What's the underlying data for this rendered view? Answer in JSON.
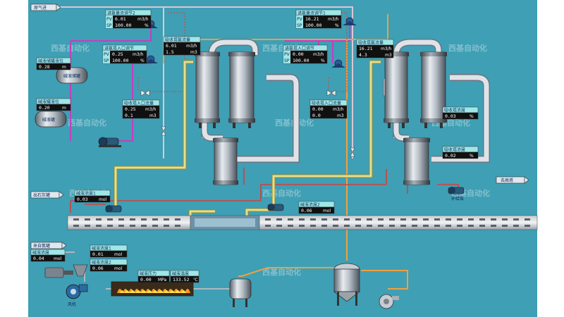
{
  "colors": {
    "background": "#3f9fb4",
    "panel_title": "#9fe7e7",
    "panel_value": "#101010",
    "steam_pipe": "#c8a8c8",
    "pipe_yellow": "#d7d27a",
    "pipe_orange": "#f0a040",
    "pipe_purple": "#c040c0",
    "pipe_red": "#d04040"
  },
  "labels": {
    "inlet_gas": "原气进",
    "out_gas": "去高塔",
    "left_tank_top": "碱液储罐",
    "left_tank_bottom": "碱液罐",
    "pump_right": "补给泵",
    "fan": "风机",
    "mix_in": "出石灰罐",
    "ammonia_in": "来自氨罐"
  },
  "watermark": "西基自动化",
  "panels": [
    {
      "id": "p1",
      "title": "进氨量流调节2",
      "pv": "6.01",
      "pv_unit": "m3/h",
      "sp": "100.00",
      "sp_unit": "%"
    },
    {
      "id": "p2",
      "title": "进氨量流调节1",
      "pv": "16.21",
      "pv_unit": "m3/h",
      "sp": "100.00",
      "sp_unit": "%"
    },
    {
      "id": "p3",
      "title": "进氨塔入口调节",
      "pv": "0.25",
      "pv_unit": "m3/h",
      "sp": "100.00",
      "sp_unit": "%"
    },
    {
      "id": "p4",
      "title": "进氨塔入口调节",
      "pv": "0.00",
      "pv_unit": "m3/h",
      "sp": "100.00",
      "sp_unit": "%"
    },
    {
      "id": "p5",
      "title": "吸收塔氨流量",
      "pv": "6.01",
      "pv_unit": "m3/h",
      "sp": "1.5",
      "sp_unit": "m3"
    },
    {
      "id": "p6",
      "title": "吸收塔氨流量",
      "pv": "16.21",
      "pv_unit": "m3/h",
      "sp": "4.3",
      "sp_unit": "m3"
    },
    {
      "id": "p7",
      "title": "碱液储罐液位",
      "pv": "0.28",
      "pv_unit": "m"
    },
    {
      "id": "p8",
      "title": "碱液罐液位",
      "pv": "0.20",
      "pv_unit": "m"
    },
    {
      "id": "p9",
      "title": "吸收塔入口流量",
      "pv": "0.25",
      "pv_unit": "m3/h",
      "sp": "0.1",
      "sp_unit": "m3"
    },
    {
      "id": "p10",
      "title": "吸收塔入口流量",
      "pv": "0.00",
      "pv_unit": "m3/h",
      "sp": "0.0",
      "sp_unit": "m3"
    },
    {
      "id": "p11",
      "title": "吸收塔浓度",
      "pv": "0.03",
      "pv_unit": "%"
    },
    {
      "id": "p12",
      "title": "吸收塔浓度",
      "pv": "0.02",
      "pv_unit": "%"
    },
    {
      "id": "p13",
      "title": "碱液浓度1",
      "pv": "0.03",
      "pv_unit": "mol"
    },
    {
      "id": "p14",
      "title": "碱液浓度2",
      "pv": "0.06",
      "pv_unit": "mol"
    },
    {
      "id": "p15",
      "title": "碱液浓度",
      "pv": "0.04",
      "pv_unit": "mol"
    },
    {
      "id": "p16",
      "title": "碱液浓度1",
      "pv": "0.01",
      "pv_unit": "mol"
    },
    {
      "id": "p17",
      "title": "碱液浓度2",
      "pv": "0.06",
      "pv_unit": "mol"
    },
    {
      "id": "p18",
      "title": "碱液压力",
      "pv": "0.00",
      "pv_unit": "MPa"
    },
    {
      "id": "p19",
      "title": "碱液温度",
      "pv": "133.52",
      "pv_unit": "℃"
    }
  ],
  "row_tags": {
    "pv": "PV",
    "sp": "SP"
  }
}
